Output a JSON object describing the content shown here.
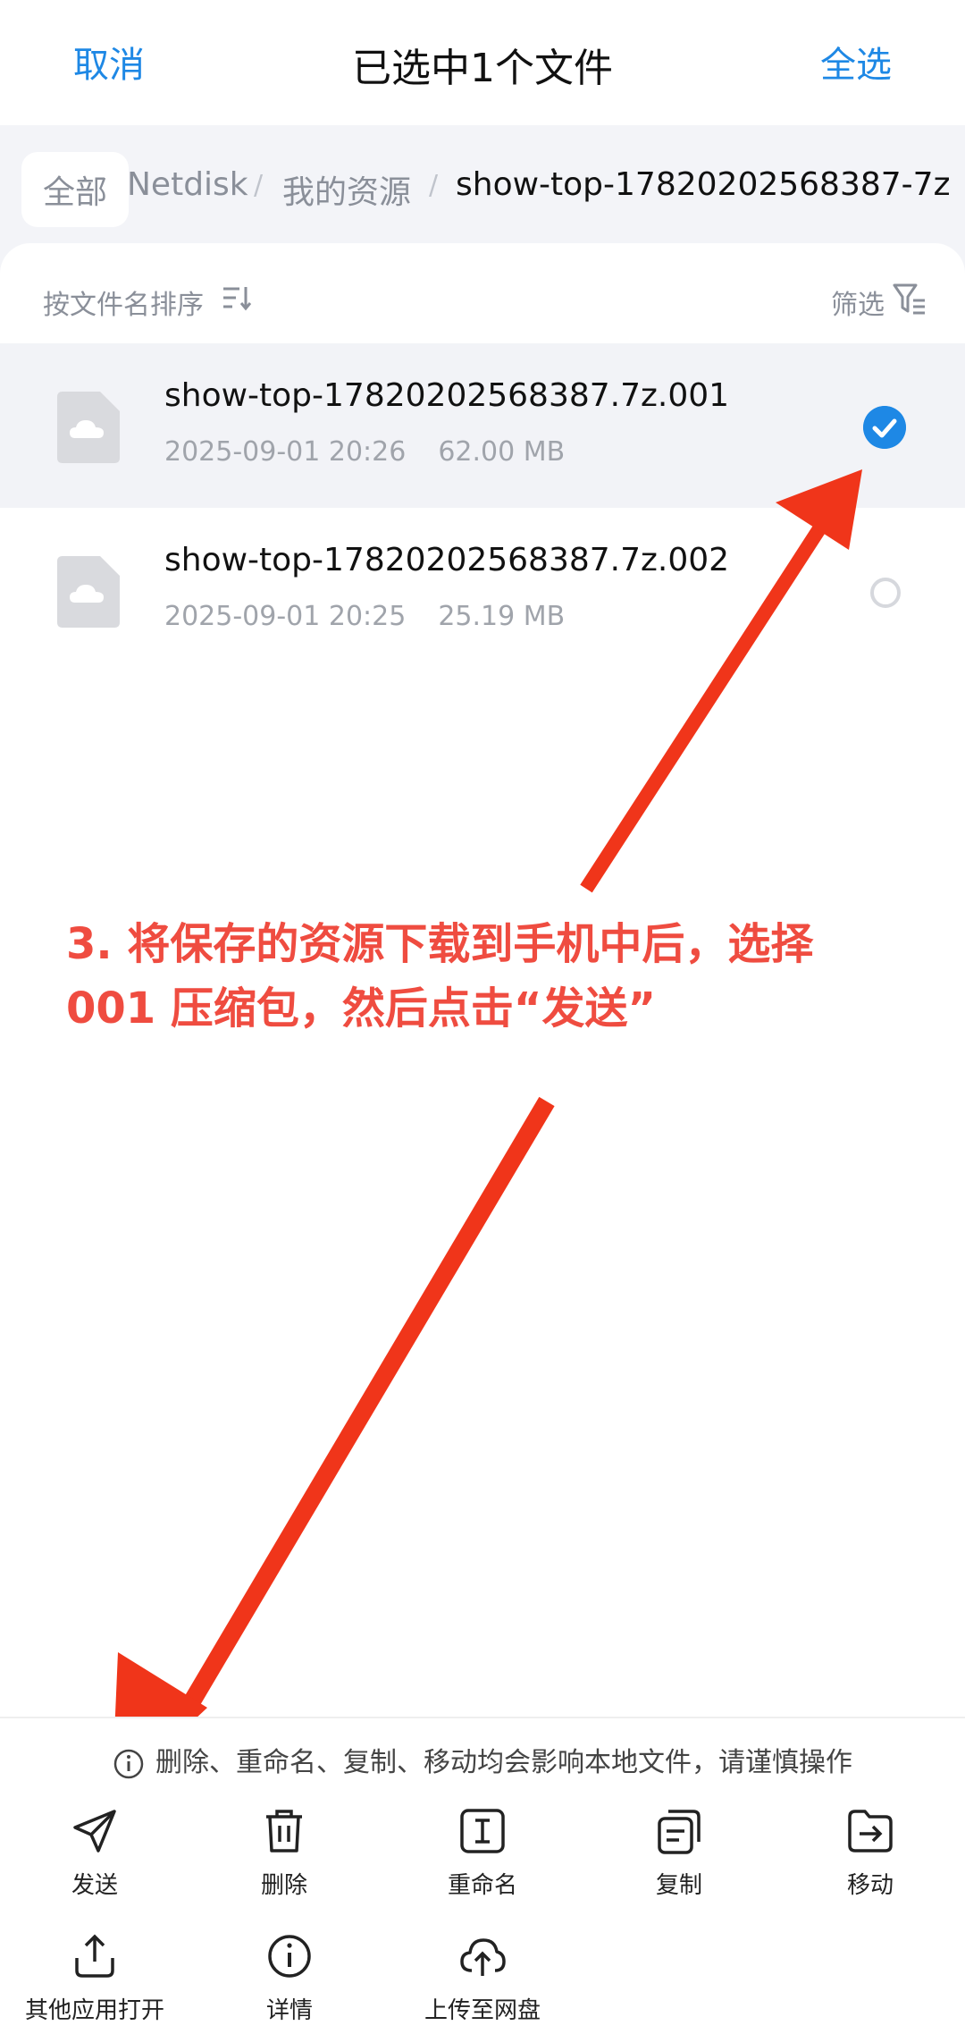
{
  "header": {
    "cancel_label": "取消",
    "title": "已选中1个文件",
    "select_all_label": "全选"
  },
  "breadcrumb": {
    "all": "全部",
    "items": [
      "Netdisk",
      "我的资源",
      "show-top-17820202568387-7z"
    ],
    "separator": "/"
  },
  "sortbar": {
    "sort_label": "按文件名排序",
    "filter_label": "筛选"
  },
  "files": [
    {
      "name": "show-top-17820202568387.7z.001",
      "date": "2025-09-01 20:26",
      "size": "62.00 MB",
      "selected": true
    },
    {
      "name": "show-top-17820202568387.7z.002",
      "date": "2025-09-01 20:25",
      "size": "25.19 MB",
      "selected": false
    }
  ],
  "annotation": {
    "text": "3. 将保存的资源下载到手机中后，选择 001 压缩包，然后点击“发送”",
    "color": "#ef4c40"
  },
  "bottom": {
    "warning": "删除、重命名、复制、移动均会影响本地文件，请谨慎操作",
    "actions": [
      {
        "label": "发送",
        "icon": "send-icon"
      },
      {
        "label": "删除",
        "icon": "trash-icon"
      },
      {
        "label": "重命名",
        "icon": "rename-icon"
      },
      {
        "label": "复制",
        "icon": "copy-icon"
      },
      {
        "label": "移动",
        "icon": "move-icon"
      },
      {
        "label": "其他应用打开",
        "icon": "share-upload-icon"
      },
      {
        "label": "详情",
        "icon": "info-icon"
      },
      {
        "label": "上传至网盘",
        "icon": "cloud-upload-icon"
      }
    ]
  },
  "colors": {
    "accent": "#1e88e5",
    "arrow": "#f0351a"
  }
}
